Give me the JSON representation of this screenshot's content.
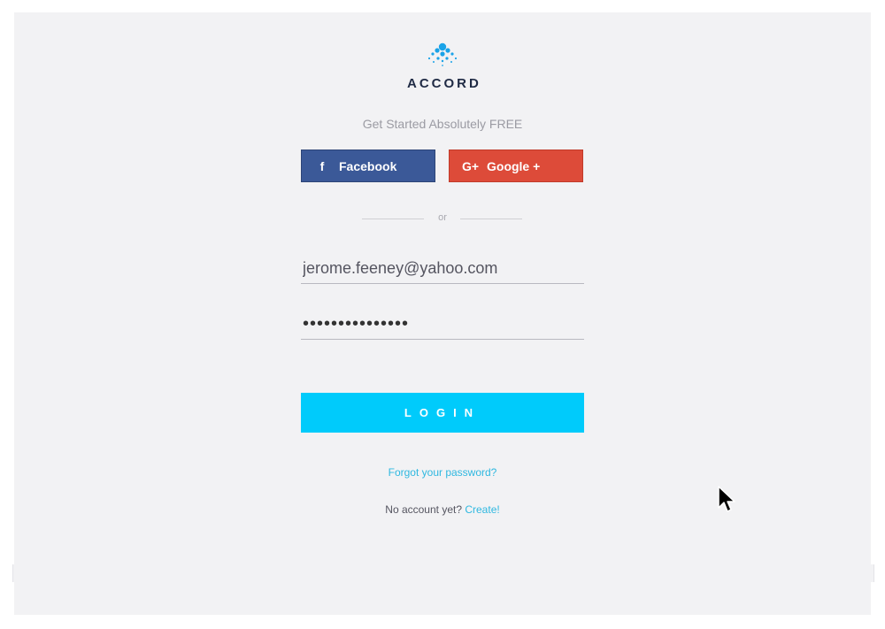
{
  "brand": {
    "name": "ACCORD",
    "logo_icon": "dot-cluster-logo",
    "accent": "#00cbfb",
    "dark": "#1f2a44"
  },
  "tagline": "Get Started Absolutely FREE",
  "social": {
    "facebook": {
      "label": "Facebook",
      "icon": "facebook-icon",
      "glyph": "f",
      "color": "#3b5998"
    },
    "google": {
      "label": "Google +",
      "icon": "google-plus-icon",
      "glyph": "G+",
      "color": "#dd4b39"
    }
  },
  "divider_text": "or",
  "form": {
    "email_value": "jerome.feeney@yahoo.com",
    "password_mask": "•••••••••••••••",
    "login_label": "LOGIN"
  },
  "links": {
    "forgot": "Forgot your password?",
    "no_account": "No account yet?",
    "create": "Create!"
  }
}
